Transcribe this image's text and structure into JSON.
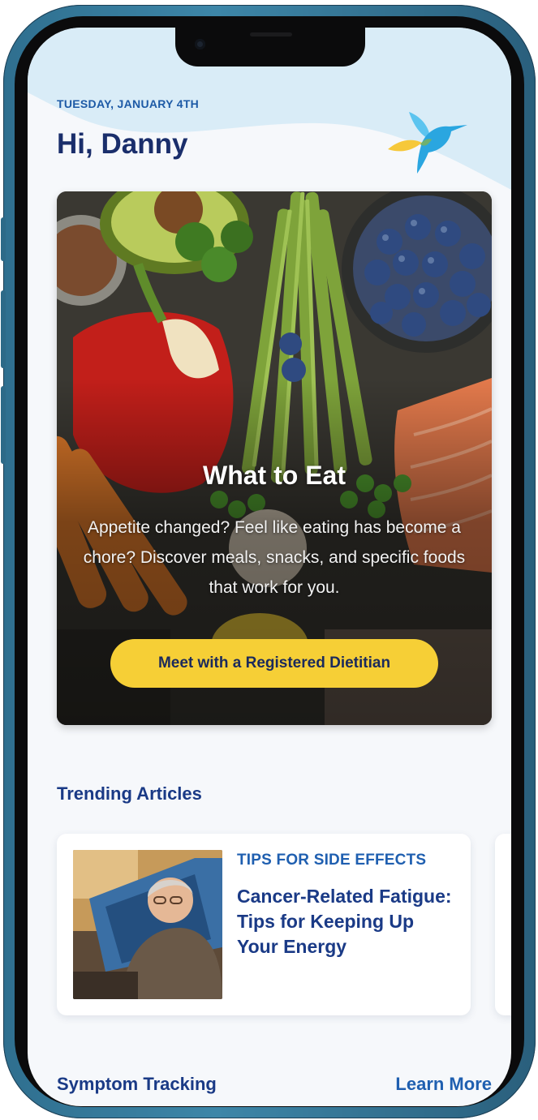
{
  "header": {
    "date": "TUESDAY, JANUARY 4TH",
    "greeting": "Hi, Danny"
  },
  "hero": {
    "title": "What to Eat",
    "body": "Appetite changed? Feel like eating has become a chore? Discover meals, snacks, and specific foods that work for you.",
    "cta_label": "Meet with a Registered Dietitian"
  },
  "trending": {
    "title": "Trending Articles",
    "articles": [
      {
        "category": "TIPS FOR SIDE EFFECTS",
        "headline": "Cancer-Related Fatigue: Tips for Keeping Up Your Energy"
      }
    ]
  },
  "symptom_tracking": {
    "title": "Symptom Tracking",
    "link_label": "Learn More"
  },
  "colors": {
    "accent_yellow": "#f6cf36",
    "navy": "#1a2e6b",
    "brand_blue": "#1f5fb0",
    "wave": "#d9ecf7"
  }
}
